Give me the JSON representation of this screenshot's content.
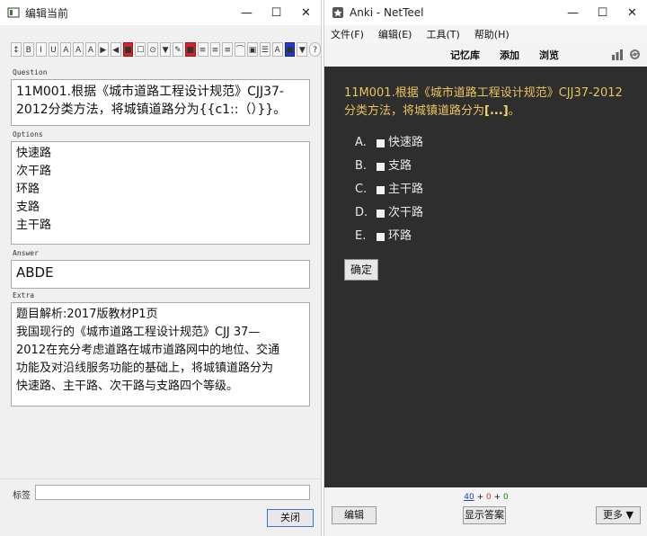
{
  "editor": {
    "title": "编辑当前",
    "toolbar_buttons": [
      "↕",
      "B",
      "I",
      "U",
      "A",
      "A",
      "A",
      "▶",
      "◀",
      "■",
      "☐",
      "⊙",
      "▼",
      "✎",
      "■",
      "≡",
      "≡",
      "≡",
      "⌒",
      "▣",
      "☰",
      "A",
      "■",
      "▼",
      "?"
    ],
    "fields": [
      {
        "label": "Question",
        "lines": [
          "11M001.根据《城市道路工程设计规范》CJJ37-",
          "2012分类方法，将城镇道路分为{{c1::（）}}。"
        ]
      },
      {
        "label": "Options",
        "lines": [
          "快速路",
          "次干路",
          "环路",
          "支路",
          "主干路"
        ]
      },
      {
        "label": "Answer",
        "lines": [
          "ABDE"
        ]
      },
      {
        "label": "Extra",
        "lines": [
          "题目解析:2017版教材P1页",
          "我国现行的《城市道路工程设计规范》CJJ 37—",
          "2012在充分考虑道路在城市道路网中的地位、交通",
          "功能及对沿线服务功能的基础上，将城镇道路分为",
          "快速路、主干路、次干路与支路四个等级。"
        ]
      }
    ],
    "tags_label": "标签",
    "close_button": "关闭"
  },
  "anki": {
    "title": "Anki - NetTeel",
    "menu": [
      "文件(F)",
      "编辑(E)",
      "工具(T)",
      "帮助(H)"
    ],
    "nav": [
      "记忆库",
      "添加",
      "浏览"
    ],
    "question_prefix": "11M001.根据《城市道路工程设计规范》CJJ37-2012分类方法，将城镇道路分为",
    "question_cloze": "[...]",
    "question_suffix": "。",
    "options": [
      {
        "letter": "A.",
        "text": "快速路"
      },
      {
        "letter": "B.",
        "text": "支路"
      },
      {
        "letter": "C.",
        "text": "主干路"
      },
      {
        "letter": "D.",
        "text": "次干路"
      },
      {
        "letter": "E.",
        "text": "环路"
      }
    ],
    "confirm_button": "确定",
    "counts": {
      "new": "40",
      "learn": "0",
      "review": "0",
      "sep": "+"
    },
    "edit_button": "编辑",
    "show_answer_button": "显示答案",
    "more_button": "更多 ▼"
  },
  "colors": {
    "card_background": "#2e2e2e",
    "question_text": "#e8c35e",
    "new_count": "#2040c0",
    "learn_count": "#c0392b",
    "review_count": "#1a7f1a"
  }
}
